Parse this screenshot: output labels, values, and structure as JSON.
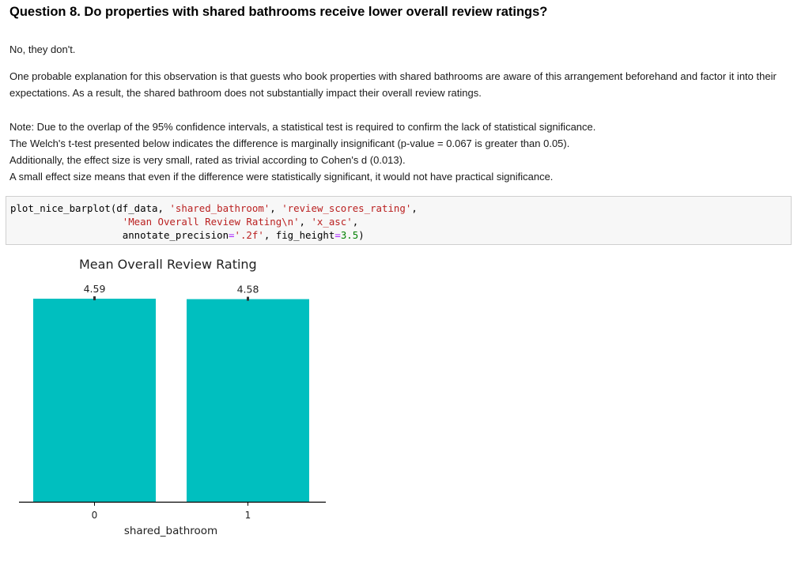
{
  "question": {
    "title": "Question 8. Do properties with shared bathrooms receive lower overall review ratings?"
  },
  "answer": "No, they don't.",
  "explanation": "One probable explanation for this observation is that guests who book properties with shared bathrooms are aware of this arrangement beforehand and factor it into their expectations. As a result, the shared bathroom does not substantially impact their overall review ratings.",
  "note_lines": [
    "Note: Due to the overlap of the 95% confidence intervals, a statistical test is required to confirm the lack of statistical significance.",
    "The Welch's t-test presented below indicates the difference is marginally insignificant (p-value = 0.067 is greater than 0.05).",
    "Additionally, the effect size is very small, rated as trivial according to Cohen's d (0.013).",
    "A small effect size means that even if the difference were statistically significant, it would not have practical significance."
  ],
  "code": {
    "func": "plot_nice_barplot",
    "arg_df": "df_data",
    "arg_x": "'shared_bathroom'",
    "arg_y": "'review_scores_rating'",
    "arg_title": "'Mean Overall Review Rating\\n'",
    "arg_order": "'x_asc'",
    "kw_precision_name": "annotate_precision",
    "kw_precision_val": "'.2f'",
    "kw_height_name": "fig_height",
    "kw_height_val": "3.5"
  },
  "colors": {
    "bar": "#00bfbf",
    "axis": "#000000",
    "string_token": "#ba2121",
    "number_token": "#008000"
  },
  "chart_data": {
    "type": "bar",
    "title": "Mean Overall Review Rating",
    "xlabel": "shared_bathroom",
    "ylabel": "",
    "categories": [
      "0",
      "1"
    ],
    "values": [
      4.59,
      4.58
    ],
    "value_labels": [
      "4.59",
      "4.58"
    ],
    "ylim": [
      0,
      4.59
    ],
    "grid": false,
    "show_yaxis": false,
    "error_bars": true
  }
}
